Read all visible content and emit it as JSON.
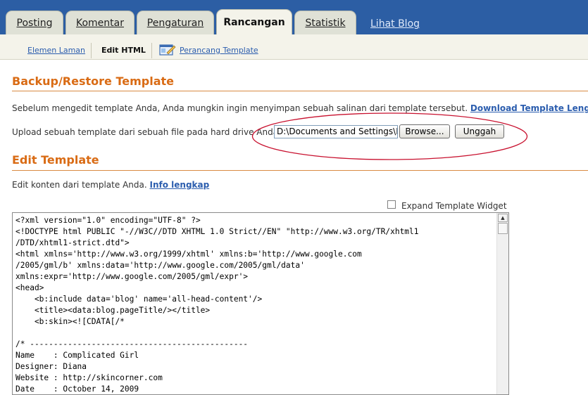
{
  "tabs": {
    "posting": "Posting",
    "komentar": "Komentar",
    "pengaturan": "Pengaturan",
    "rancangan": "Rancangan",
    "statistik": "Statistik",
    "lihat_blog": "Lihat Blog"
  },
  "subtabs": {
    "elemen_laman": "Elemen Laman",
    "edit_html": "Edit HTML",
    "perancang_template": "Perancang Template",
    "designer_icon": "template-designer-icon"
  },
  "backup": {
    "title": "Backup/Restore Template",
    "description": "Sebelum mengedit template Anda, Anda mungkin ingin menyimpan sebuah salinan dari template tersebut.",
    "download_link": "Download Template Lengkap",
    "upload_label": "Upload sebuah template dari sebuah file pada hard drive Anda:",
    "file_value": "D:\\Documents and Settings\\H",
    "browse_button": "Browse...",
    "unggah_button": "Unggah"
  },
  "edit": {
    "title": "Edit Template",
    "description": "Edit konten dari template Anda.",
    "info_link": "Info lengkap",
    "expand_widget_label": "Expand Template Widget",
    "expand_widget_checked": false,
    "code_lines": [
      "<?xml version=\"1.0\" encoding=\"UTF-8\" ?>",
      "<!DOCTYPE html PUBLIC \"-//W3C//DTD XHTML 1.0 Strict//EN\" \"http://www.w3.org/TR/xhtml1",
      "/DTD/xhtml1-strict.dtd\">",
      "<html xmlns='http://www.w3.org/1999/xhtml' xmlns:b='http://www.google.com",
      "/2005/gml/b' xmlns:data='http://www.google.com/2005/gml/data'",
      "xmlns:expr='http://www.google.com/2005/gml/expr'>",
      "<head>",
      "    <b:include data='blog' name='all-head-content'/>",
      "    <title><data:blog.pageTitle/></title>",
      "    <b:skin><![CDATA[/*",
      "",
      "/* ----------------------------------------------",
      "Name    : Complicated Girl",
      "Designer: Diana",
      "Website : http://skincorner.com",
      "Date    : October 14, 2009"
    ]
  },
  "colors": {
    "tabbar": "#2c5ea4",
    "heading": "#d96b14",
    "link": "#2b5dae",
    "annotation": "#c8102e"
  }
}
